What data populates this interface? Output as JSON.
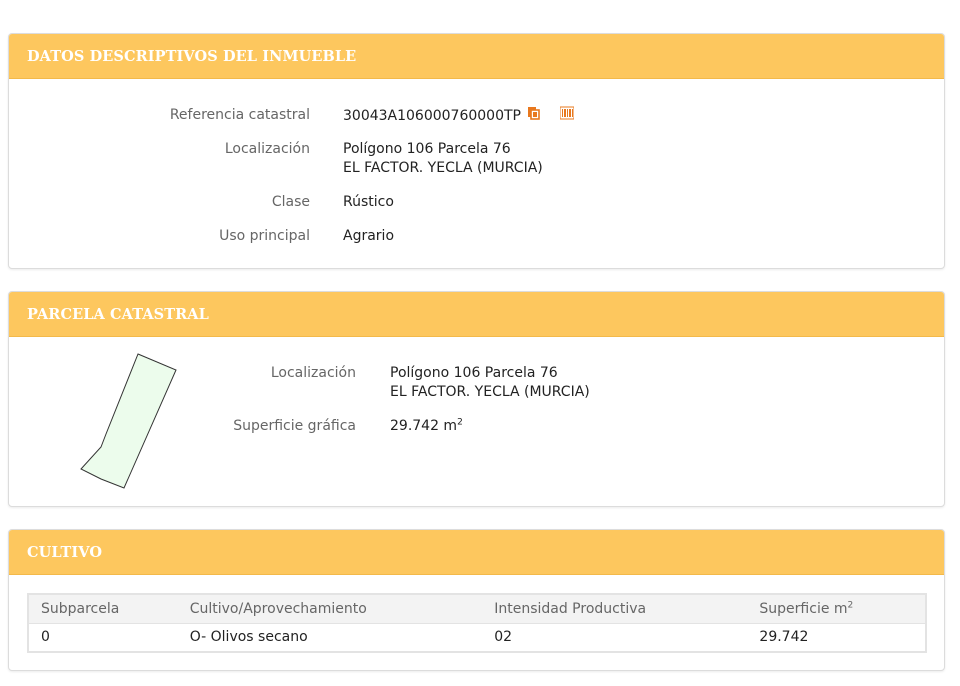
{
  "datos": {
    "title": "DATOS DESCRIPTIVOS DEL INMUEBLE",
    "referencia_label": "Referencia catastral",
    "referencia_value": "30043A106000760000TP",
    "localizacion_label": "Localización",
    "localizacion_line1": "Polígono 106 Parcela 76",
    "localizacion_line2": "EL FACTOR. YECLA (MURCIA)",
    "clase_label": "Clase",
    "clase_value": "Rústico",
    "uso_label": "Uso principal",
    "uso_value": "Agrario",
    "icons": [
      "copy-icon",
      "barcode-icon"
    ],
    "icon_color": "#e8781e"
  },
  "parcela": {
    "title": "PARCELA CATASTRAL",
    "localizacion_label": "Localización",
    "localizacion_line1": "Polígono 106 Parcela 76",
    "localizacion_line2": "EL FACTOR. YECLA (MURCIA)",
    "superficie_label": "Superficie gráfica",
    "superficie_value": "29.742 m",
    "superficie_sup": "2",
    "shape_fill": "#ecfcec",
    "shape_stroke": "#333333"
  },
  "cultivo": {
    "title": "CULTIVO",
    "headers": [
      "Subparcela",
      "Cultivo/Aprovechamiento",
      "Intensidad Productiva",
      "Superficie m"
    ],
    "header_sup": "2",
    "rows": [
      [
        "0",
        "O- Olivos secano",
        "02",
        "29.742"
      ]
    ]
  },
  "colors": {
    "header_bg": "#fdc75e",
    "header_text": "#ffffff",
    "label_text": "#666666"
  }
}
